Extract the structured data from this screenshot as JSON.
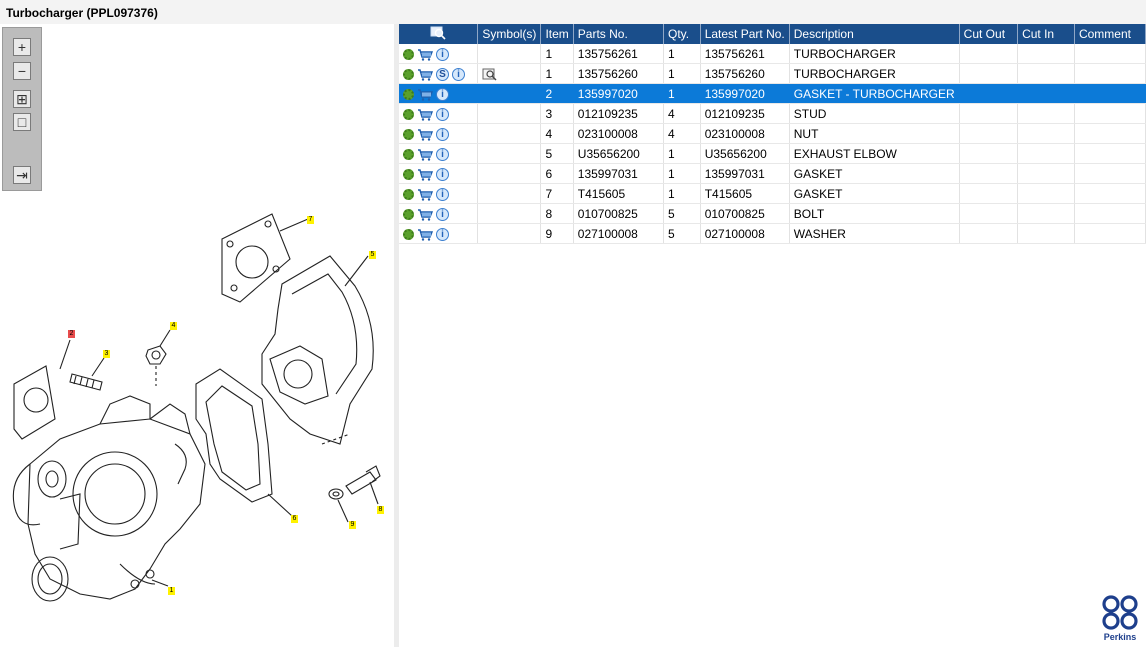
{
  "window": {
    "title": "Turbocharger (PPL097376)"
  },
  "toolbar": {
    "tools": [
      {
        "name": "zoom-in-icon",
        "glyph": "+"
      },
      {
        "name": "zoom-out-icon",
        "glyph": "−"
      },
      {
        "name": "fit-all-icon",
        "glyph": "⊞"
      },
      {
        "name": "fit-page-icon",
        "glyph": "□"
      },
      {
        "name": "export-icon",
        "glyph": "⇥"
      }
    ]
  },
  "callouts": [
    {
      "label": "7",
      "color": "#fff200"
    },
    {
      "label": "5",
      "color": "#fff200"
    },
    {
      "label": "4",
      "color": "#fff200"
    },
    {
      "label": "2",
      "color": "#e84c4c"
    },
    {
      "label": "3",
      "color": "#fff200"
    },
    {
      "label": "6",
      "color": "#fff200"
    },
    {
      "label": "8",
      "color": "#fff200"
    },
    {
      "label": "9",
      "color": "#fff200"
    },
    {
      "label": "1",
      "color": "#fff200"
    }
  ],
  "table": {
    "headers": [
      "Symbol(s)",
      "Item",
      "Parts No.",
      "Qty.",
      "Latest Part No.",
      "Description",
      "Cut Out",
      "Cut In",
      "Comment"
    ],
    "selected_index": 2,
    "rows": [
      {
        "item": "1",
        "part_no": "135756261",
        "qty": "1",
        "latest": "135756261",
        "desc": "TURBOCHARGER",
        "cut_out": "",
        "cut_in": "",
        "comment": "",
        "service": false,
        "note": false
      },
      {
        "item": "1",
        "part_no": "135756260",
        "qty": "1",
        "latest": "135756260",
        "desc": "TURBOCHARGER",
        "cut_out": "",
        "cut_in": "",
        "comment": "",
        "service": true,
        "note": true
      },
      {
        "item": "2",
        "part_no": "135997020",
        "qty": "1",
        "latest": "135997020",
        "desc": "GASKET - TURBOCHARGER",
        "cut_out": "",
        "cut_in": "",
        "comment": "",
        "service": false,
        "note": false
      },
      {
        "item": "3",
        "part_no": "012109235",
        "qty": "4",
        "latest": "012109235",
        "desc": "STUD",
        "cut_out": "",
        "cut_in": "",
        "comment": "",
        "service": false,
        "note": false
      },
      {
        "item": "4",
        "part_no": "023100008",
        "qty": "4",
        "latest": "023100008",
        "desc": "NUT",
        "cut_out": "",
        "cut_in": "",
        "comment": "",
        "service": false,
        "note": false
      },
      {
        "item": "5",
        "part_no": "U35656200",
        "qty": "1",
        "latest": "U35656200",
        "desc": "EXHAUST ELBOW",
        "cut_out": "",
        "cut_in": "",
        "comment": "",
        "service": false,
        "note": false
      },
      {
        "item": "6",
        "part_no": "135997031",
        "qty": "1",
        "latest": "135997031",
        "desc": "GASKET",
        "cut_out": "",
        "cut_in": "",
        "comment": "",
        "service": false,
        "note": false
      },
      {
        "item": "7",
        "part_no": "T415605",
        "qty": "1",
        "latest": "T415605",
        "desc": "GASKET",
        "cut_out": "",
        "cut_in": "",
        "comment": "",
        "service": false,
        "note": false
      },
      {
        "item": "8",
        "part_no": "010700825",
        "qty": "5",
        "latest": "010700825",
        "desc": "BOLT",
        "cut_out": "",
        "cut_in": "",
        "comment": "",
        "service": false,
        "note": false
      },
      {
        "item": "9",
        "part_no": "027100008",
        "qty": "5",
        "latest": "027100008",
        "desc": "WASHER",
        "cut_out": "",
        "cut_in": "",
        "comment": "",
        "service": false,
        "note": false
      }
    ]
  },
  "icons": {
    "gear": "settings-gear-icon",
    "cart": "shopping-cart-icon",
    "info": "info-icon",
    "service": "service-s-icon",
    "note": "note-magnifier-icon",
    "column_search": "column-search-icon"
  },
  "colors": {
    "header": "#1a4e8b",
    "selected": "#0c7ad8",
    "accent_green": "#5aa02c"
  },
  "brand": {
    "name": "Perkins"
  }
}
